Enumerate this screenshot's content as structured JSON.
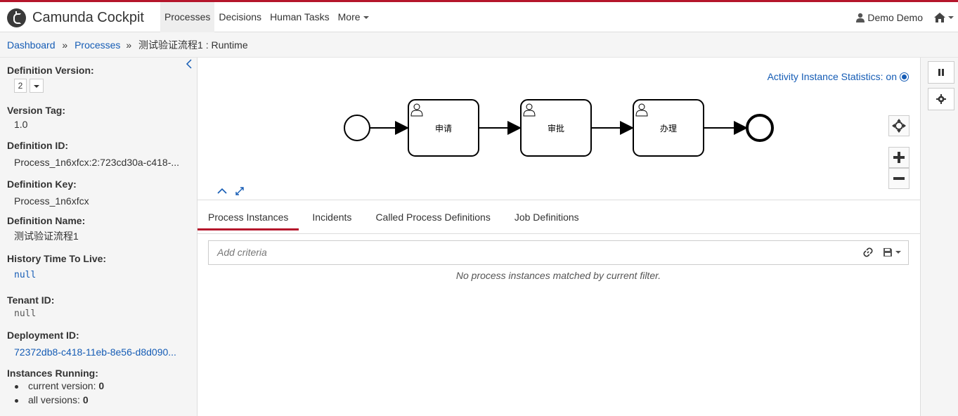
{
  "nav": {
    "brand": "Camunda Cockpit",
    "items": [
      "Processes",
      "Decisions",
      "Human Tasks",
      "More"
    ],
    "user": "Demo Demo"
  },
  "breadcrumb": {
    "dashboard": "Dashboard",
    "processes": "Processes",
    "current": "测试验证流程1 : Runtime",
    "separator": "»"
  },
  "sidebar": {
    "definition_version_label": "Definition Version:",
    "definition_version": "2",
    "version_tag_label": "Version Tag:",
    "version_tag": "1.0",
    "definition_id_label": "Definition ID:",
    "definition_id": "Process_1n6xfcx:2:723cd30a-c418-...",
    "definition_key_label": "Definition Key:",
    "definition_key": "Process_1n6xfcx",
    "definition_name_label": "Definition Name:",
    "definition_name": "测试验证流程1",
    "history_ttl_label": "History Time To Live:",
    "history_ttl": "null",
    "tenant_id_label": "Tenant ID:",
    "tenant_id": "null",
    "deployment_id_label": "Deployment ID:",
    "deployment_id": "72372db8-c418-11eb-8e56-d8d090...",
    "instances_running_label": "Instances Running:",
    "current_version_label": "current version:",
    "current_version_count": "0",
    "all_versions_label": "all versions:",
    "all_versions_count": "0"
  },
  "diagram": {
    "stats_label": "Activity Instance Statistics: on",
    "tasks": [
      "申请",
      "审批",
      "办理"
    ]
  },
  "tabs": [
    "Process Instances",
    "Incidents",
    "Called Process Definitions",
    "Job Definitions"
  ],
  "filter": {
    "placeholder": "Add criteria",
    "empty_message": "No process instances matched by current filter."
  },
  "colors": {
    "accent": "#b5152b",
    "link": "#155cb5"
  }
}
